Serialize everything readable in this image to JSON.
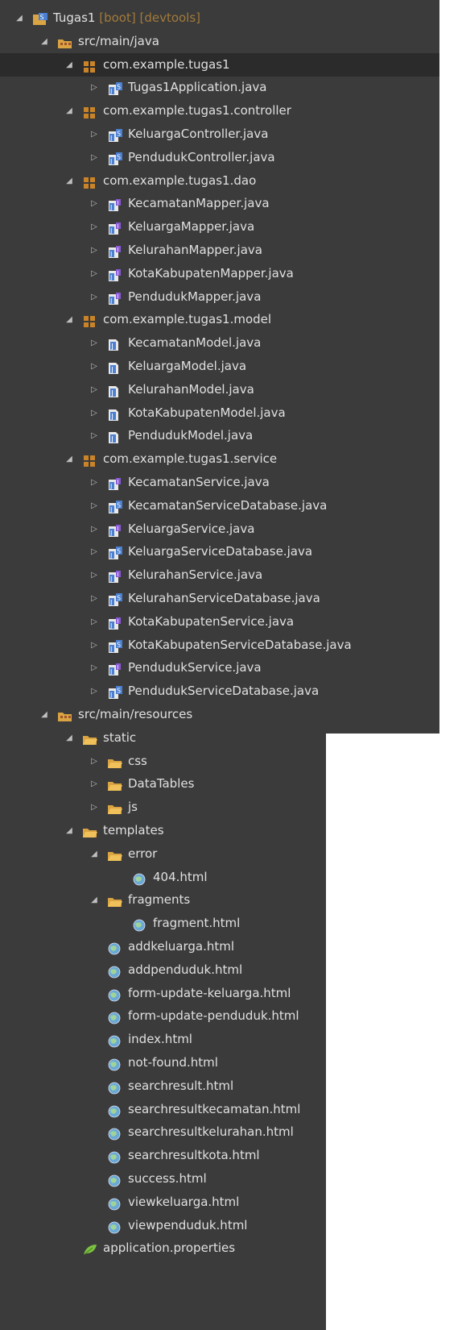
{
  "project": {
    "name": "Tugas1",
    "tags": "[boot] [devtools]"
  },
  "rows": [
    {
      "depth": 0,
      "arrow": "open",
      "icon": "project-icon",
      "label": "Tugas1",
      "suffix": " [boot] [devtools]"
    },
    {
      "depth": 1,
      "arrow": "open",
      "icon": "source-folder-icon",
      "label": "src/main/java"
    },
    {
      "depth": 2,
      "arrow": "open",
      "icon": "package-icon",
      "label": "com.example.tugas1",
      "selected": true
    },
    {
      "depth": 3,
      "arrow": "closed",
      "icon": "spring-class-icon",
      "label": "Tugas1Application.java"
    },
    {
      "depth": 2,
      "arrow": "open",
      "icon": "package-icon",
      "label": "com.example.tugas1.controller"
    },
    {
      "depth": 3,
      "arrow": "closed",
      "icon": "spring-class-icon",
      "label": "KeluargaController.java"
    },
    {
      "depth": 3,
      "arrow": "closed",
      "icon": "spring-class-icon",
      "label": "PendudukController.java"
    },
    {
      "depth": 2,
      "arrow": "open",
      "icon": "package-icon",
      "label": "com.example.tugas1.dao"
    },
    {
      "depth": 3,
      "arrow": "closed",
      "icon": "interface-icon",
      "label": "KecamatanMapper.java"
    },
    {
      "depth": 3,
      "arrow": "closed",
      "icon": "interface-icon",
      "label": "KeluargaMapper.java"
    },
    {
      "depth": 3,
      "arrow": "closed",
      "icon": "interface-icon",
      "label": "KelurahanMapper.java"
    },
    {
      "depth": 3,
      "arrow": "closed",
      "icon": "interface-icon",
      "label": "KotaKabupatenMapper.java"
    },
    {
      "depth": 3,
      "arrow": "closed",
      "icon": "interface-icon",
      "label": "PendudukMapper.java"
    },
    {
      "depth": 2,
      "arrow": "open",
      "icon": "package-icon",
      "label": "com.example.tugas1.model"
    },
    {
      "depth": 3,
      "arrow": "closed",
      "icon": "java-file-icon",
      "label": "KecamatanModel.java"
    },
    {
      "depth": 3,
      "arrow": "closed",
      "icon": "java-file-icon",
      "label": "KeluargaModel.java"
    },
    {
      "depth": 3,
      "arrow": "closed",
      "icon": "java-file-icon",
      "label": "KelurahanModel.java"
    },
    {
      "depth": 3,
      "arrow": "closed",
      "icon": "java-file-icon",
      "label": "KotaKabupatenModel.java"
    },
    {
      "depth": 3,
      "arrow": "closed",
      "icon": "java-file-icon",
      "label": "PendudukModel.java"
    },
    {
      "depth": 2,
      "arrow": "open",
      "icon": "package-icon",
      "label": "com.example.tugas1.service"
    },
    {
      "depth": 3,
      "arrow": "closed",
      "icon": "interface-icon",
      "label": "KecamatanService.java"
    },
    {
      "depth": 3,
      "arrow": "closed",
      "icon": "spring-class-icon",
      "label": "KecamatanServiceDatabase.java"
    },
    {
      "depth": 3,
      "arrow": "closed",
      "icon": "interface-icon",
      "label": "KeluargaService.java"
    },
    {
      "depth": 3,
      "arrow": "closed",
      "icon": "spring-class-icon",
      "label": "KeluargaServiceDatabase.java"
    },
    {
      "depth": 3,
      "arrow": "closed",
      "icon": "interface-icon",
      "label": "KelurahanService.java"
    },
    {
      "depth": 3,
      "arrow": "closed",
      "icon": "spring-class-icon",
      "label": "KelurahanServiceDatabase.java"
    },
    {
      "depth": 3,
      "arrow": "closed",
      "icon": "interface-icon",
      "label": "KotaKabupatenService.java"
    },
    {
      "depth": 3,
      "arrow": "closed",
      "icon": "spring-class-icon",
      "label": "KotaKabupatenServiceDatabase.java"
    },
    {
      "depth": 3,
      "arrow": "closed",
      "icon": "interface-icon",
      "label": "PendudukService.java"
    },
    {
      "depth": 3,
      "arrow": "closed",
      "icon": "spring-class-icon",
      "label": "PendudukServiceDatabase.java"
    },
    {
      "depth": 1,
      "arrow": "open",
      "icon": "source-folder-icon",
      "label": "src/main/resources"
    },
    {
      "depth": 2,
      "arrow": "open",
      "icon": "folder-icon",
      "label": "static"
    },
    {
      "depth": 3,
      "arrow": "closed",
      "icon": "folder-icon",
      "label": "css"
    },
    {
      "depth": 3,
      "arrow": "closed",
      "icon": "folder-icon",
      "label": "DataTables"
    },
    {
      "depth": 3,
      "arrow": "closed",
      "icon": "folder-icon",
      "label": "js"
    },
    {
      "depth": 2,
      "arrow": "open",
      "icon": "folder-icon",
      "label": "templates"
    },
    {
      "depth": 3,
      "arrow": "open",
      "icon": "folder-icon",
      "label": "error"
    },
    {
      "depth": 4,
      "arrow": "none",
      "icon": "html-file-icon",
      "label": "404.html"
    },
    {
      "depth": 3,
      "arrow": "open",
      "icon": "folder-icon",
      "label": "fragments"
    },
    {
      "depth": 4,
      "arrow": "none",
      "icon": "html-file-icon",
      "label": "fragment.html"
    },
    {
      "depth": 3,
      "arrow": "none",
      "icon": "html-file-icon",
      "label": "addkeluarga.html"
    },
    {
      "depth": 3,
      "arrow": "none",
      "icon": "html-file-icon",
      "label": "addpenduduk.html"
    },
    {
      "depth": 3,
      "arrow": "none",
      "icon": "html-file-icon",
      "label": "form-update-keluarga.html"
    },
    {
      "depth": 3,
      "arrow": "none",
      "icon": "html-file-icon",
      "label": "form-update-penduduk.html"
    },
    {
      "depth": 3,
      "arrow": "none",
      "icon": "html-file-icon",
      "label": "index.html"
    },
    {
      "depth": 3,
      "arrow": "none",
      "icon": "html-file-icon",
      "label": "not-found.html"
    },
    {
      "depth": 3,
      "arrow": "none",
      "icon": "html-file-icon",
      "label": "searchresult.html"
    },
    {
      "depth": 3,
      "arrow": "none",
      "icon": "html-file-icon",
      "label": "searchresultkecamatan.html"
    },
    {
      "depth": 3,
      "arrow": "none",
      "icon": "html-file-icon",
      "label": "searchresultkelurahan.html"
    },
    {
      "depth": 3,
      "arrow": "none",
      "icon": "html-file-icon",
      "label": "searchresultkota.html"
    },
    {
      "depth": 3,
      "arrow": "none",
      "icon": "html-file-icon",
      "label": "success.html"
    },
    {
      "depth": 3,
      "arrow": "none",
      "icon": "html-file-icon",
      "label": "viewkeluarga.html"
    },
    {
      "depth": 3,
      "arrow": "none",
      "icon": "html-file-icon",
      "label": "viewpenduduk.html"
    },
    {
      "depth": 2,
      "arrow": "none",
      "icon": "properties-icon",
      "label": "application.properties"
    }
  ],
  "colors": {
    "background": "#3b3b3b",
    "selected": "#2b2b2b",
    "text": "#e0e0e0",
    "decoration": "#a37a3a"
  }
}
